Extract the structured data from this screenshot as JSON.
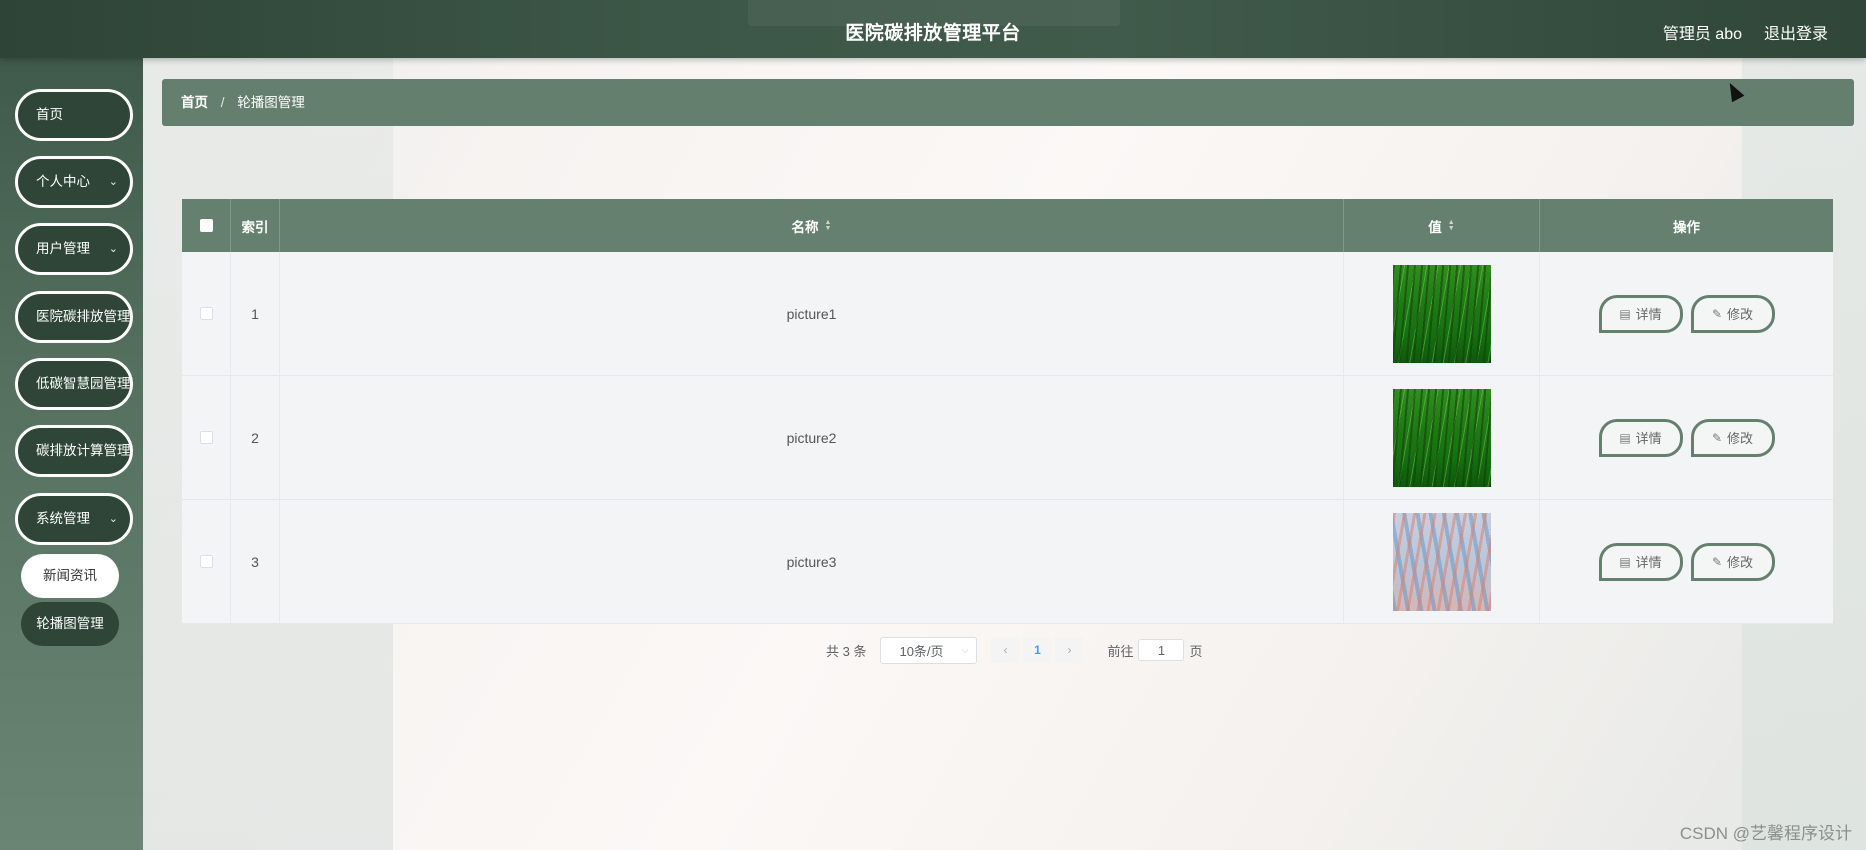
{
  "header": {
    "title": "医院碳排放管理平台",
    "user_label": "管理员 abo",
    "logout_label": "退出登录"
  },
  "sidebar": {
    "items": [
      {
        "label": "首页",
        "has_children": false
      },
      {
        "label": "个人中心",
        "has_children": true
      },
      {
        "label": "用户管理",
        "has_children": true
      },
      {
        "label": "医院碳排放管理",
        "has_children": false
      },
      {
        "label": "低碳智慧园管理",
        "has_children": false
      },
      {
        "label": "碳排放计算管理",
        "has_children": false
      },
      {
        "label": "系统管理",
        "has_children": true,
        "expanded": true
      }
    ],
    "sub_items": [
      {
        "label": "新闻资讯",
        "active": true
      },
      {
        "label": "轮播图管理",
        "active": false
      }
    ]
  },
  "breadcrumb": {
    "home": "首页",
    "separator": "/",
    "current": "轮播图管理"
  },
  "table": {
    "headers": {
      "index": "索引",
      "name": "名称",
      "value": "值",
      "actions": "操作"
    },
    "rows": [
      {
        "index": "1",
        "name": "picture1",
        "image": "green-grass-thumbnail"
      },
      {
        "index": "2",
        "name": "picture2",
        "image": "green-grass-thumbnail"
      },
      {
        "index": "3",
        "name": "picture3",
        "image": "pastel-abstract-thumbnail"
      }
    ],
    "detail_label": "详情",
    "edit_label": "修改"
  },
  "pagination": {
    "total": "共 3 条",
    "page_size": "10条/页",
    "current_page": "1",
    "goto_prefix": "前往",
    "goto_value": "1",
    "goto_suffix": "页"
  },
  "watermark": "CSDN @艺馨程序设计",
  "colors": {
    "primary": "#65806f",
    "header_dark": "#2d4436",
    "menu_dark": "#2e4537",
    "page_active": "#409eff"
  }
}
